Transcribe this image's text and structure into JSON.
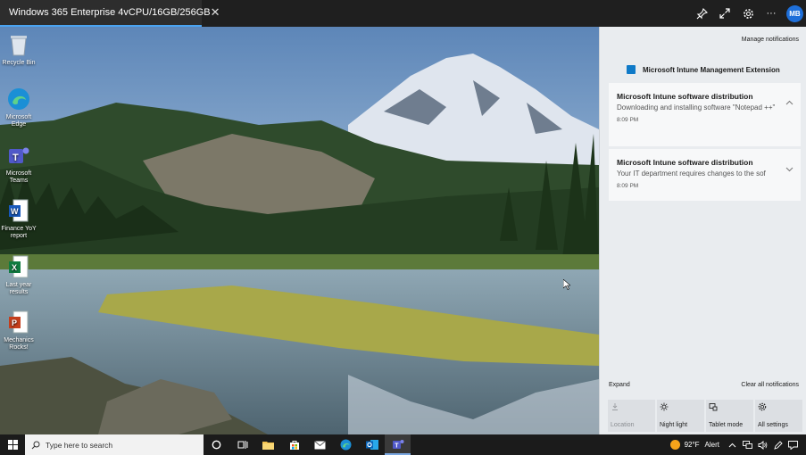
{
  "session": {
    "title": "Windows 365 Enterprise 4vCPU/16GB/256GB",
    "close_glyph": "✕",
    "actions": [
      "pin-icon",
      "fullscreen-icon",
      "gear-icon",
      "more-icon"
    ],
    "more_glyph": "···",
    "avatar_initials": "MB"
  },
  "desktop_icons": [
    {
      "label": "Recycle Bin",
      "icon": "recycle-bin-icon"
    },
    {
      "label": "Microsoft Edge",
      "icon": "edge-icon"
    },
    {
      "label": "Microsoft Teams",
      "icon": "teams-icon"
    },
    {
      "label": "Finance YoY report",
      "icon": "word-icon"
    },
    {
      "label": "Last year results",
      "icon": "excel-icon"
    },
    {
      "label": "Mechanics Rocks!",
      "icon": "powerpoint-icon"
    }
  ],
  "notifications": {
    "manage_label": "Manage notifications",
    "group_name": "Microsoft Intune Management Extension",
    "items": [
      {
        "title": "Microsoft Intune software distribution",
        "body": "Downloading and installing software \"Notepad ++\"",
        "time": "8:09 PM",
        "chevron": "up"
      },
      {
        "title": "Microsoft Intune software distribution",
        "body": "Your IT department requires changes to the sof",
        "time": "8:09 PM",
        "chevron": "down"
      }
    ],
    "expand_label": "Expand",
    "clear_label": "Clear all notifications",
    "quick_actions": [
      {
        "label": "Location",
        "icon": "location-icon",
        "enabled": false
      },
      {
        "label": "Night light",
        "icon": "night-light-icon",
        "enabled": true
      },
      {
        "label": "Tablet mode",
        "icon": "tablet-mode-icon",
        "enabled": true
      },
      {
        "label": "All settings",
        "icon": "settings-icon",
        "enabled": true
      }
    ]
  },
  "taskbar": {
    "search_placeholder": "Type here to search",
    "pinned": [
      "cortana-icon",
      "task-view-icon",
      "file-explorer-icon",
      "store-icon",
      "mail-icon",
      "edge-icon",
      "outlook-icon",
      "teams-icon"
    ],
    "weather_temp": "92°F",
    "weather_alert": "Alert"
  },
  "colors": {
    "accent": "#4aa3f0",
    "avatar": "#1e6fd9",
    "panel_bg": "#e9ecef"
  }
}
